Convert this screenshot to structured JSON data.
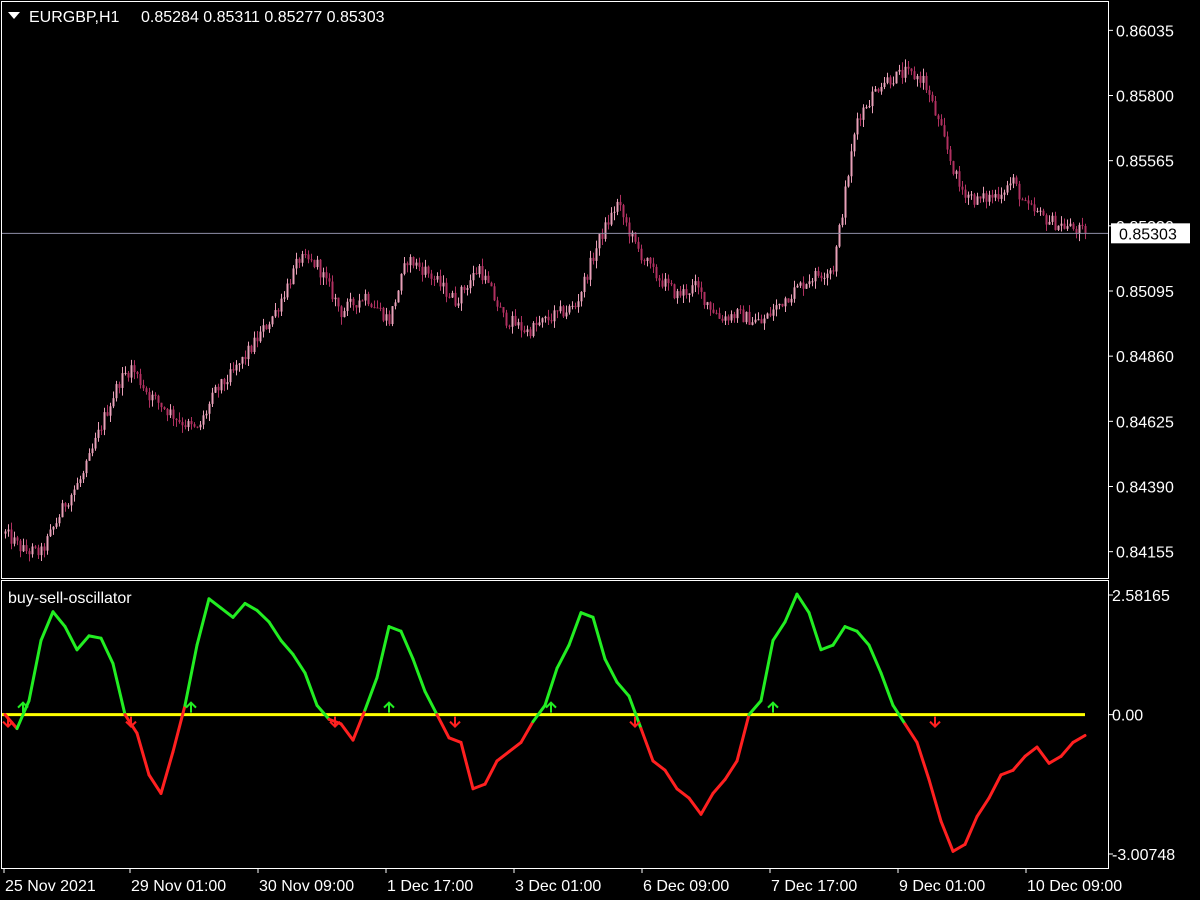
{
  "main_chart": {
    "symbol_header": "EURGBP,H1",
    "ohlc_header": "0.85284 0.85311 0.85277 0.85303",
    "current_price_label": "0.85303",
    "current_price": 0.85303,
    "menu_icon": "triangle-down-icon",
    "price_ticks": [
      "0.86035",
      "0.85800",
      "0.85565",
      "0.85330",
      "0.85095",
      "0.84860",
      "0.84625",
      "0.84390",
      "0.84155"
    ]
  },
  "oscillator": {
    "name": "buy-sell-oscillator",
    "ticks": [
      "2.58165",
      "0.00",
      "-3.00748"
    ]
  },
  "time_axis": {
    "labels": [
      "25 Nov 2021",
      "29 Nov 01:00",
      "30 Nov 09:00",
      "1 Dec 17:00",
      "3 Dec 01:00",
      "6 Dec 09:00",
      "7 Dec 17:00",
      "9 Dec 01:00",
      "10 Dec 09:00"
    ]
  },
  "colors": {
    "background": "#000000",
    "frame": "#ffffff",
    "candle": "#e9a0b8",
    "candle_dark": "#b03060",
    "price_line": "#8f8fa8",
    "bull_line": "#22ee22",
    "bear_line": "#ff2020",
    "zero_line": "#ffff00"
  },
  "chart_data": [
    {
      "type": "candlestick",
      "title": "EURGBP,H1",
      "ylim": [
        0.8406,
        0.8613
      ],
      "y_ticks": [
        0.86035,
        0.858,
        0.85565,
        0.8533,
        0.85095,
        0.8486,
        0.84625,
        0.8439,
        0.84155
      ],
      "close_path": {
        "bar": [
          0,
          6,
          12,
          20,
          26,
          33,
          38,
          42,
          48,
          58,
          64,
          70,
          76,
          82,
          90,
          98,
          104,
          112,
          120,
          128,
          134,
          140,
          150,
          158,
          166,
          174,
          182,
          190,
          198,
          204,
          210,
          216,
          224,
          230,
          238,
          244,
          252,
          260,
          268,
          276,
          284,
          292,
          300,
          306,
          312,
          318,
          324,
          330,
          336,
          340,
          346,
          350,
          356,
          360
        ],
        "price": [
          0.8422,
          0.8416,
          0.8415,
          0.8433,
          0.8443,
          0.8464,
          0.8477,
          0.8482,
          0.8472,
          0.8463,
          0.8459,
          0.8473,
          0.848,
          0.8489,
          0.8502,
          0.8521,
          0.8519,
          0.8502,
          0.8508,
          0.8499,
          0.8521,
          0.8517,
          0.8506,
          0.8518,
          0.85,
          0.8495,
          0.85,
          0.8504,
          0.8528,
          0.8541,
          0.8526,
          0.8516,
          0.8508,
          0.8511,
          0.85,
          0.8501,
          0.8498,
          0.8507,
          0.8514,
          0.8518,
          0.8572,
          0.8585,
          0.8588,
          0.8586,
          0.8567,
          0.8547,
          0.8542,
          0.8544,
          0.8549,
          0.854,
          0.8536,
          0.8534,
          0.8532,
          0.85303
        ]
      },
      "bars": 361,
      "current_price": 0.85303
    },
    {
      "type": "line",
      "title": "buy-sell-oscillator",
      "ylim": [
        -3.00748,
        2.58165
      ],
      "y_ticks": [
        2.58165,
        0.0,
        -3.00748
      ],
      "x_labels": [
        "25 Nov 2021",
        "29 Nov 01:00",
        "30 Nov 09:00",
        "1 Dec 17:00",
        "3 Dec 01:00",
        "6 Dec 09:00",
        "7 Dec 17:00",
        "9 Dec 01:00",
        "10 Dec 09:00"
      ],
      "bar": [
        0,
        4,
        8,
        12,
        16,
        20,
        24,
        28,
        32,
        36,
        40,
        44,
        48,
        52,
        56,
        60,
        64,
        68,
        72,
        76,
        80,
        84,
        88,
        92,
        96,
        100,
        104,
        108,
        112,
        116,
        120,
        124,
        128,
        132,
        136,
        140,
        144,
        148,
        152,
        156,
        160,
        164,
        168,
        172,
        176,
        180,
        184,
        188,
        192,
        196,
        200,
        204,
        208,
        212,
        216,
        220,
        224,
        228,
        232,
        236,
        240,
        244,
        248,
        252,
        256,
        260,
        264,
        268,
        272,
        276,
        280,
        284,
        288,
        292,
        296,
        300,
        304,
        308,
        312,
        316,
        320,
        324,
        328,
        332,
        336,
        340,
        344,
        348,
        352,
        356,
        360
      ],
      "value": [
        0.0,
        -0.3,
        0.3,
        1.6,
        2.22,
        1.9,
        1.4,
        1.7,
        1.65,
        1.1,
        0.0,
        -0.4,
        -1.3,
        -1.7,
        -0.8,
        0.2,
        1.5,
        2.5,
        2.3,
        2.1,
        2.4,
        2.25,
        2.0,
        1.6,
        1.3,
        0.9,
        0.2,
        -0.1,
        -0.2,
        -0.55,
        0.1,
        0.8,
        1.9,
        1.8,
        1.2,
        0.5,
        0.0,
        -0.5,
        -0.6,
        -1.6,
        -1.5,
        -1.0,
        -0.8,
        -0.6,
        -0.15,
        0.2,
        1.0,
        1.5,
        2.2,
        2.1,
        1.2,
        0.7,
        0.4,
        -0.3,
        -1.0,
        -1.2,
        -1.6,
        -1.8,
        -2.15,
        -1.7,
        -1.4,
        -1.0,
        0.0,
        0.3,
        1.6,
        2.0,
        2.6,
        2.2,
        1.4,
        1.5,
        1.9,
        1.8,
        1.5,
        0.9,
        0.2,
        -0.2,
        -0.6,
        -1.4,
        -2.3,
        -2.95,
        -2.8,
        -2.2,
        -1.8,
        -1.3,
        -1.2,
        -0.9,
        -0.7,
        -1.05,
        -0.9,
        -0.6,
        -0.45
      ],
      "zero_line": 0.0,
      "up_cross_bars": [
        6,
        62,
        128,
        182,
        256
      ],
      "down_cross_bars": [
        1,
        42,
        110,
        150,
        210,
        310
      ]
    }
  ]
}
